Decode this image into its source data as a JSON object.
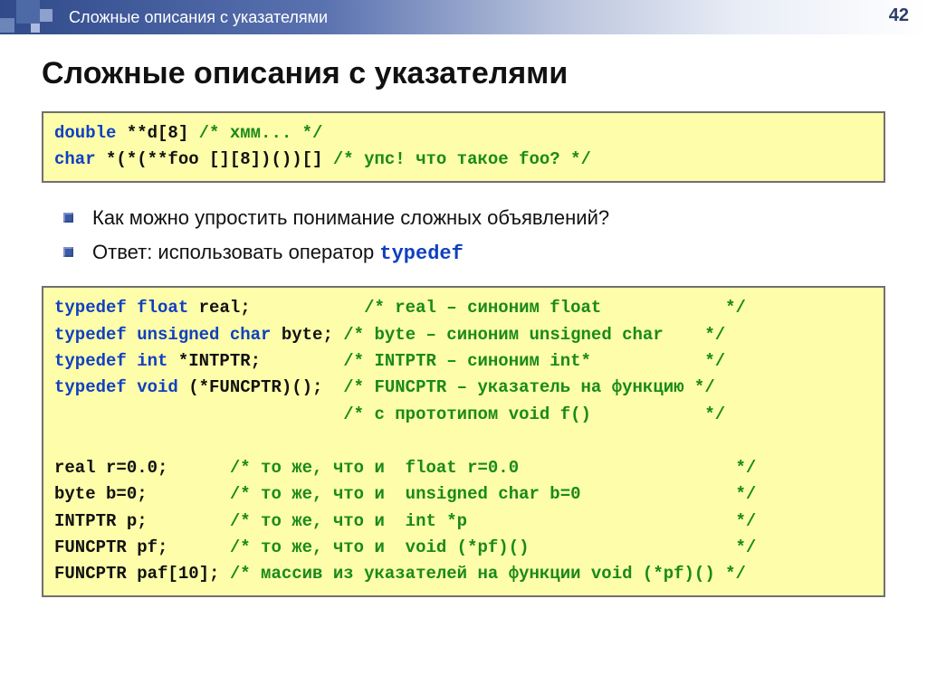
{
  "header": {
    "breadcrumb": "Сложные описания с указателями",
    "page_number": "42"
  },
  "title": "Сложные описания с указателями",
  "code1": {
    "line1_kw": "double",
    "line1_rest": " **d[8] ",
    "line1_cmt": "/* хмм... */",
    "line2_kw": "char",
    "line2_rest": " *(*(**foo [][8])())[] ",
    "line2_cmt": "/* упс! что такое foo? */"
  },
  "bullets": {
    "item1": "Как можно упростить понимание сложных объявлений?",
    "item2_prefix": "Ответ: использовать оператор ",
    "item2_code": "typedef"
  },
  "code2": {
    "l1_kw": "typedef float",
    "l1_rest": " real;           ",
    "l1_cmt": "/* real – синоним float            */",
    "l2_kw": "typedef unsigned char",
    "l2_rest": " byte; ",
    "l2_cmt": "/* byte – синоним unsigned char    */",
    "l3_kw": "typedef int",
    "l3_rest": " *INTPTR;        ",
    "l3_cmt": "/* INTPTR – синоним int*           */",
    "l4_kw": "typedef void",
    "l4_rest": " (*FUNCPTR)();  ",
    "l4_cmt": "/* FUNCPTR – указатель на функцию */",
    "l5_pad": "                            ",
    "l5_cmt": "/* с прототипом void f()           */",
    "blank": " ",
    "l6_rest": "real r=0.0;      ",
    "l6_cmt": "/* то же, что и  float r=0.0                     */",
    "l7_rest": "byte b=0;        ",
    "l7_cmt": "/* то же, что и  unsigned char b=0               */",
    "l8_rest": "INTPTR p;        ",
    "l8_cmt": "/* то же, что и  int *p                          */",
    "l9_rest": "FUNCPTR pf;      ",
    "l9_cmt": "/* то же, что и  void (*pf)()                    */",
    "l10_rest": "FUNCPTR paf[10]; ",
    "l10_cmt": "/* массив из указателей на функции void (*pf)() */"
  }
}
